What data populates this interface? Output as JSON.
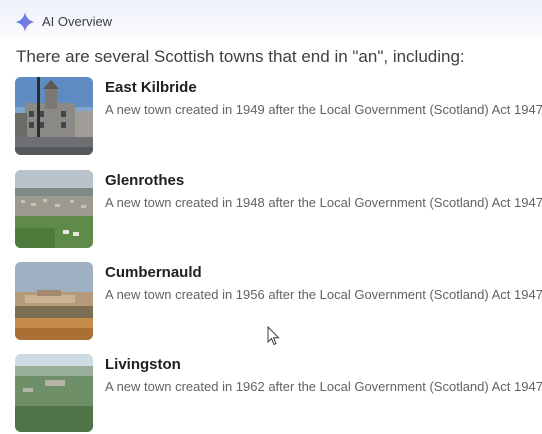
{
  "overview": {
    "title": "AI Overview",
    "intro": "There are several Scottish towns that end in \"an\", including:"
  },
  "towns": [
    {
      "name": "East Kilbride",
      "description": "A new town created in 1949 after the Local Government (Scotland) Act 1947"
    },
    {
      "name": "Glenrothes",
      "description": "A new town created in 1948 after the Local Government (Scotland) Act 1947"
    },
    {
      "name": "Cumbernauld",
      "description": "A new town created in 1956 after the Local Government (Scotland) Act 1947"
    },
    {
      "name": "Livingston",
      "description": "A new town created in 1962 after the Local Government (Scotland) Act 1947"
    }
  ],
  "colors": {
    "sparkle_start": "#4285f4",
    "sparkle_end": "#9b72cb",
    "text_primary": "#202124",
    "text_secondary": "#5f6368"
  },
  "icons": {
    "header": "ai-sparkle-icon",
    "pointer": "mouse-cursor-icon"
  }
}
